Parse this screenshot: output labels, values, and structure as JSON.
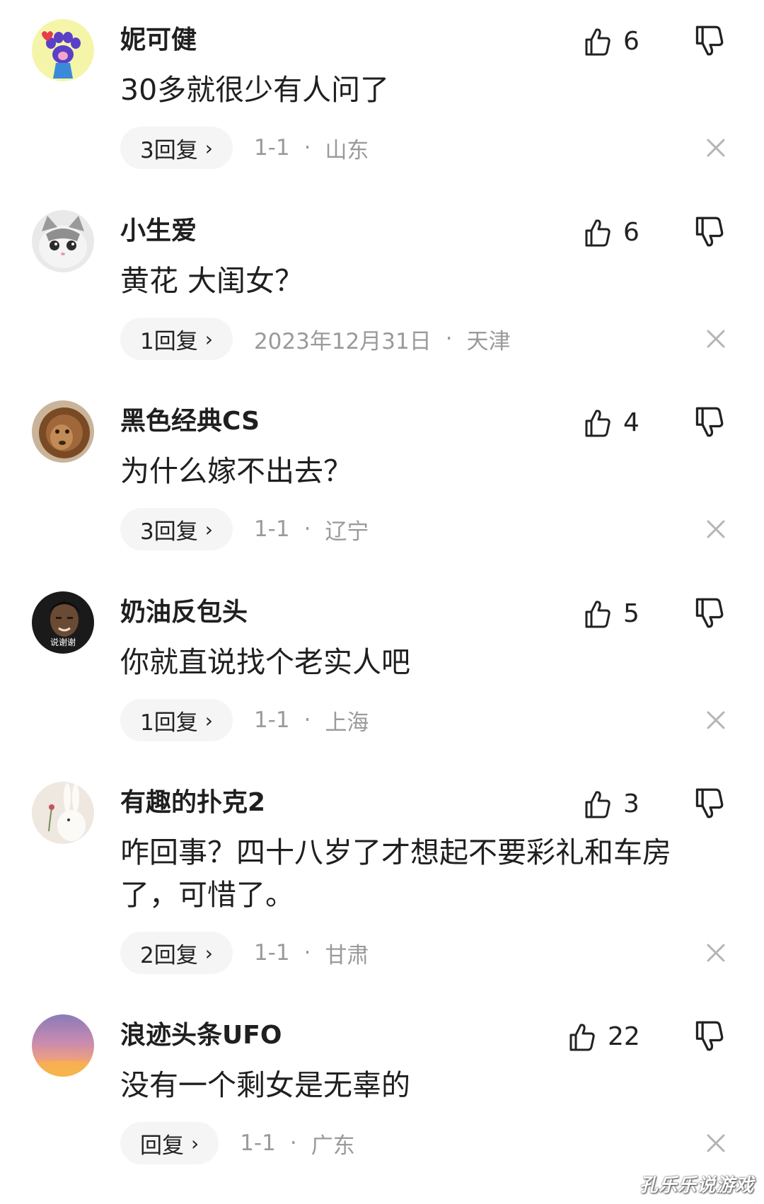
{
  "colors": {
    "text_primary": "#1f1f1f",
    "text_meta": "#9a9a9a",
    "pill_bg": "#f5f5f5"
  },
  "comments": [
    {
      "username": "妮可健",
      "content": "30多就很少有人问了",
      "likes": "6",
      "replies": "3回复",
      "date": "1-1",
      "location": "山东",
      "avatar_icon": "cat-paw-icon"
    },
    {
      "username": "小生爱",
      "content": "黄花 大闺女？",
      "likes": "6",
      "replies": "1回复",
      "date": "2023年12月31日",
      "location": "天津",
      "avatar_icon": "kitten-avatar-icon"
    },
    {
      "username": "黑色经典CS",
      "content": "为什么嫁不出去？",
      "likes": "4",
      "replies": "3回复",
      "date": "1-1",
      "location": "辽宁",
      "avatar_icon": "lion-avatar-icon"
    },
    {
      "username": "奶油反包头",
      "content": "你就直说找个老实人吧",
      "likes": "5",
      "replies": "1回复",
      "date": "1-1",
      "location": "上海",
      "avatar_icon": "man-portrait-avatar-icon",
      "avatar_caption": "说谢谢"
    },
    {
      "username": "有趣的扑克2",
      "content": "咋回事？四十八岁了才想起不要彩礼和车房了，可惜了。",
      "likes": "3",
      "replies": "2回复",
      "date": "1-1",
      "location": "甘肃",
      "avatar_icon": "rabbit-avatar-icon"
    },
    {
      "username": "浪迹头条UFO",
      "content": "没有一个剩女是无辜的",
      "likes": "22",
      "replies": "回复",
      "date": "1-1",
      "location": "广东",
      "avatar_icon": "sunset-avatar-icon"
    }
  ],
  "ui": {
    "reply_chevron": "›",
    "meta_separator": "·"
  },
  "watermark": "孔乐乐说游戏"
}
